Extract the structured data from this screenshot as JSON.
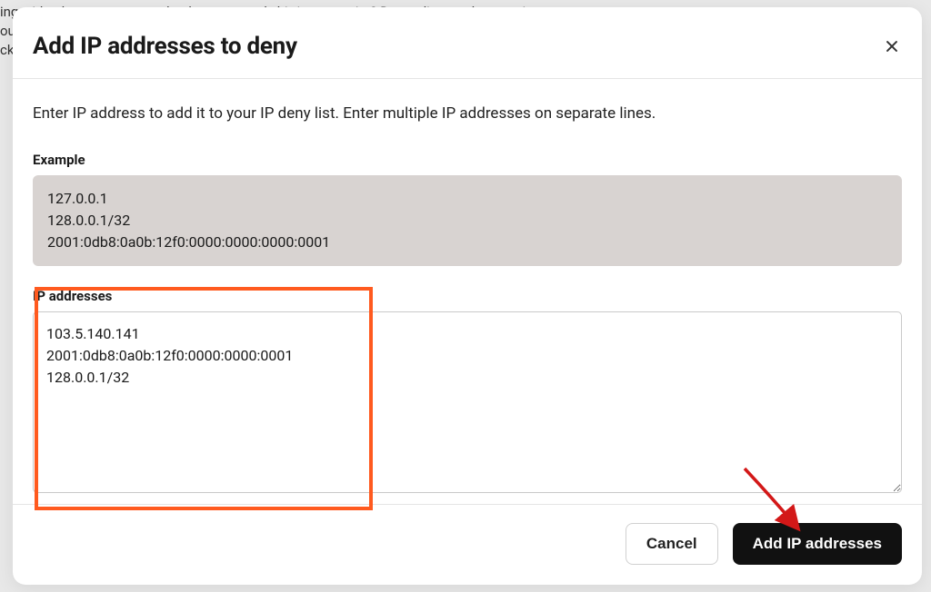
{
  "backdrop": {
    "bg_text_snippet": "ing with a bot, spammer, or hacker constantly hitting your site? Depending on the severity,\nou\nck"
  },
  "modal": {
    "title": "Add IP addresses to deny",
    "instruction": "Enter IP address to add it to your IP deny list. Enter multiple IP addresses on separate lines.",
    "example_label": "Example",
    "example_text": "127.0.0.1\n128.0.0.1/32\n2001:0db8:0a0b:12f0:0000:0000:0000:0001",
    "ip_label": "IP addresses",
    "ip_value": "103.5.140.141\n2001:0db8:0a0b:12f0:0000:0000:0001\n128.0.0.1/32",
    "cancel_label": "Cancel",
    "submit_label": "Add IP addresses"
  },
  "colors": {
    "highlight": "#ff5a1f",
    "arrow": "#d31818",
    "primary_btn": "#111111"
  }
}
